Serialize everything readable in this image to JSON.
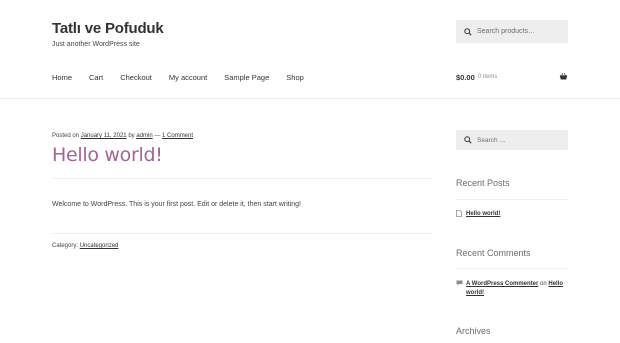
{
  "site": {
    "title": "Tatlı ve Pofuduk",
    "description": "Just another WordPress site"
  },
  "header_search": {
    "placeholder": "Search products…"
  },
  "nav": {
    "items": [
      "Home",
      "Cart",
      "Checkout",
      "My account",
      "Sample Page",
      "Shop"
    ]
  },
  "cart": {
    "total": "$0.00",
    "count": "0 items"
  },
  "post": {
    "posted_on_label": "Posted on",
    "date": "January 11, 2021",
    "by_label": "by",
    "author": "admin",
    "dash": "—",
    "comments": "1 Comment",
    "title": "Hello world!",
    "body": "Welcome to WordPress. This is your first post. Edit or delete it, then start writing!",
    "category_label": "Category:",
    "category": "Uncategorized"
  },
  "sidebar": {
    "search_placeholder": "Search …",
    "recent_posts_title": "Recent Posts",
    "recent_posts": [
      "Hello world!"
    ],
    "recent_comments_title": "Recent Comments",
    "comment_author": "A WordPress Commenter",
    "comment_on_label": "on",
    "comment_post": "Hello world!",
    "archives_title": "Archives"
  },
  "colors": {
    "accent_purple": "#a46497",
    "text": "#43454b",
    "heading": "#333333",
    "search_bg": "#eeeeee"
  }
}
